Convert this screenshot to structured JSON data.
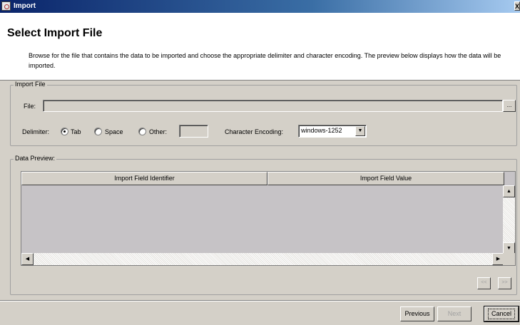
{
  "window": {
    "title": "Import",
    "close_label": "X"
  },
  "header": {
    "title": "Select Import File",
    "description": "Browse for the file that contains the data to be imported and choose the appropriate delimiter and character encoding. The preview below displays how the data will be imported."
  },
  "import_file": {
    "legend": "Import File",
    "file_label": "File:",
    "file_value": "",
    "browse_label": "...",
    "delimiter_label": "Delimiter:",
    "delimiters": [
      "Tab",
      "Space",
      "Other:"
    ],
    "selected_delimiter": "Tab",
    "other_value": "",
    "encoding_label": "Character Encoding:",
    "encoding_value": "windows-1252"
  },
  "data_preview": {
    "legend": "Data Preview:",
    "columns": [
      "Import Field Identifier",
      "Import Field Value"
    ],
    "rows": [],
    "prev_page_label": "<<",
    "next_page_label": ">>"
  },
  "footer": {
    "previous_label": "Previous",
    "next_label": "Next",
    "cancel_label": "Cancel"
  },
  "icons": {
    "app": "import-app-icon",
    "close": "close-icon",
    "dropdown": "chevron-down-icon",
    "scroll_up": "arrow-up-icon",
    "scroll_down": "arrow-down-icon",
    "scroll_left": "arrow-left-icon",
    "scroll_right": "arrow-right-icon"
  }
}
